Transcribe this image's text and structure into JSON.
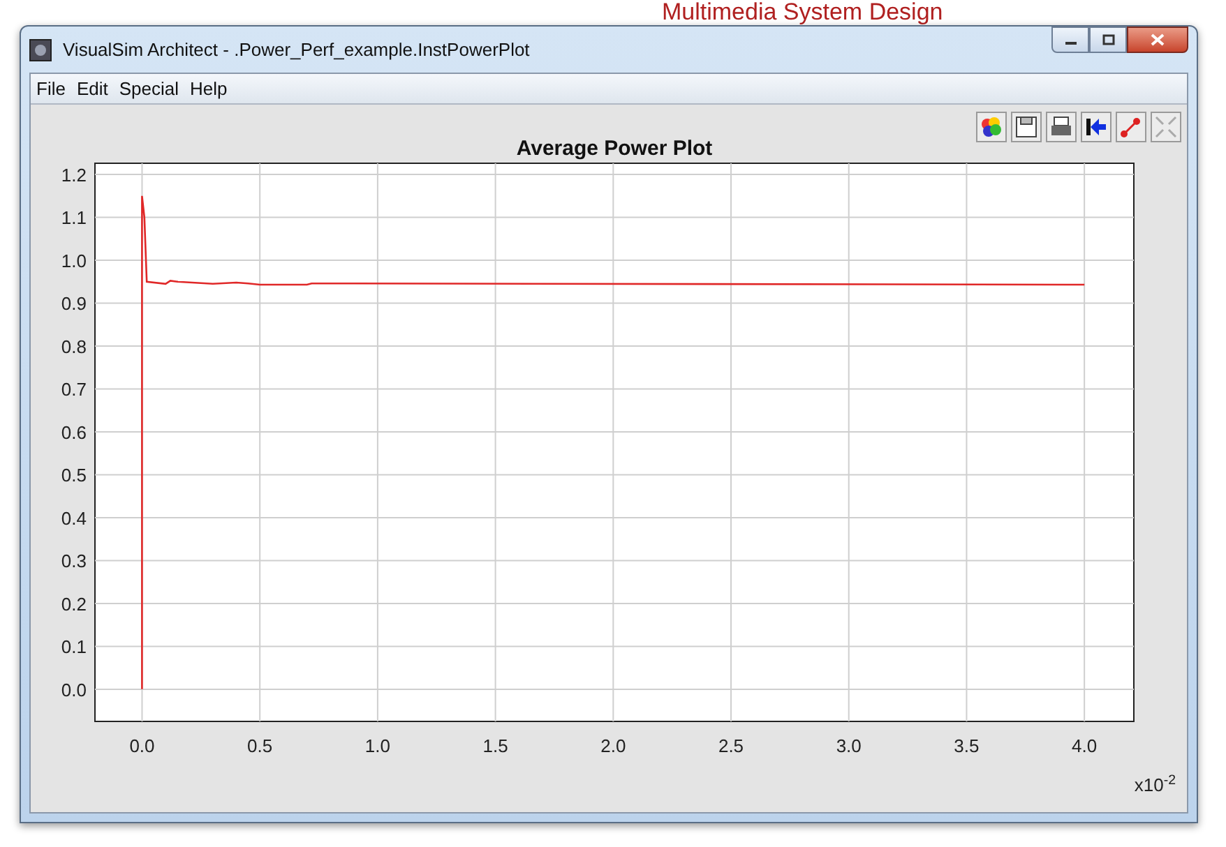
{
  "background_text": "Multimedia System Design",
  "window": {
    "title": "VisualSim Architect - .Power_Perf_example.InstPowerPlot"
  },
  "menu": [
    "File",
    "Edit",
    "Special",
    "Help"
  ],
  "chart_data": {
    "type": "line",
    "title": "Average Power Plot",
    "xlabel": "x10$^{-2}$",
    "x": [
      0,
      0,
      0.01,
      0.02,
      0.1,
      0.12,
      0.15,
      0.3,
      0.4,
      0.45,
      0.5,
      0.7,
      0.72,
      4.0
    ],
    "series": [
      {
        "color": "#e02828",
        "values": [
          0,
          1.15,
          1.1,
          0.95,
          0.945,
          0.952,
          0.95,
          0.945,
          0.948,
          0.946,
          0.943,
          0.943,
          0.946,
          0.943
        ]
      }
    ],
    "grid": true,
    "xlim": [
      -0.2,
      4.21
    ],
    "ylim": [
      -0.075,
      1.226
    ],
    "xticks": [
      {
        "value": 0,
        "label": "0.0"
      },
      {
        "value": 0.5,
        "label": "0.5"
      },
      {
        "value": 1,
        "label": "1.0"
      },
      {
        "value": 1.5,
        "label": "1.5"
      },
      {
        "value": 2,
        "label": "2.0"
      },
      {
        "value": 2.5,
        "label": "2.5"
      },
      {
        "value": 3,
        "label": "3.0"
      },
      {
        "value": 3.5,
        "label": "3.5"
      },
      {
        "value": 4,
        "label": "4.0"
      }
    ],
    "yticks": [
      {
        "value": 0,
        "label": "0.0"
      },
      {
        "value": 0.1,
        "label": "0.1"
      },
      {
        "value": 0.2,
        "label": "0.2"
      },
      {
        "value": 0.3,
        "label": "0.3"
      },
      {
        "value": 0.4,
        "label": "0.4"
      },
      {
        "value": 0.5,
        "label": "0.5"
      },
      {
        "value": 0.6,
        "label": "0.6"
      },
      {
        "value": 0.7,
        "label": "0.7"
      },
      {
        "value": 0.8,
        "label": "0.8"
      },
      {
        "value": 0.9,
        "label": "0.9"
      },
      {
        "value": 1,
        "label": "1.0"
      },
      {
        "value": 1.1,
        "label": "1.1"
      },
      {
        "value": 1.2,
        "label": "1.2"
      }
    ]
  }
}
